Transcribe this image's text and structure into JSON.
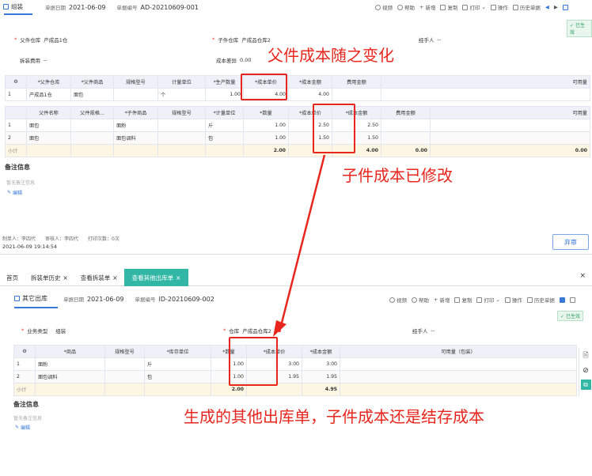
{
  "top": {
    "tab_label": "组装",
    "date_label": "单据日期",
    "date": "2021-06-09",
    "no_label": "单据编号",
    "no": "AD-20210609-001",
    "toolbar": [
      "视频",
      "帮助",
      "新增",
      "复制",
      "打印",
      "操作",
      "历史单据"
    ],
    "status": "已生效",
    "form": {
      "parent_wh_label": "父件仓库",
      "parent_wh": "产成品1仓",
      "child_wh_label": "子件仓库",
      "child_wh": "产成品仓库2",
      "handler_label": "经手人",
      "handler": "--",
      "fee_label": "拆装费用",
      "fee": "--",
      "diff_label": "成本差异",
      "diff": "0.00"
    },
    "parent_table": {
      "headers": [
        "*父件仓库",
        "*父件商品",
        "规格型号",
        "计量单位",
        "*生产数量",
        "*成本单价",
        "*成本金额",
        "费用金额",
        "可用量"
      ],
      "rows": [
        [
          "1",
          "产成品1仓",
          "面包",
          "",
          "个",
          "1.00",
          "4.00",
          "4.00",
          ""
        ]
      ]
    },
    "child_table": {
      "headers": [
        "父件名称",
        "父件规格...",
        "*子件商品",
        "规格型号",
        "*计量单位",
        "*数量",
        "*成本单价",
        "*成本金额",
        "费用金额",
        "可用量"
      ],
      "rows": [
        [
          "1",
          "面包",
          "",
          "面粉",
          "",
          "斤",
          "1.00",
          "2.50",
          "2.50",
          ""
        ],
        [
          "2",
          "面包",
          "",
          "面包调料",
          "",
          "包",
          "1.00",
          "1.50",
          "1.50",
          ""
        ]
      ],
      "subtotal_label": "小计",
      "subtotal": [
        "2.00",
        "4.00",
        "0.00",
        "0.00"
      ]
    },
    "remark_title": "备注信息",
    "remark_empty": "暂无备注信息",
    "edit": "编辑",
    "maker": "制单人：李四代",
    "auditor": "审核人：李四代",
    "print_count": "打印次数：0次",
    "timestamp": "2021-06-09 19:14:54",
    "reverse_btn": "弃审"
  },
  "bottom": {
    "tabs": [
      "首页",
      "拆装单历史",
      "查看拆装单",
      "查看其他出库单"
    ],
    "title": "其它出库",
    "date_label": "单据日期",
    "date": "2021-06-09",
    "no_label": "单据编号",
    "no": "ID-20210609-002",
    "toolbar": [
      "视频",
      "帮助",
      "新增",
      "复制",
      "打印",
      "操作",
      "历史单据"
    ],
    "status": "已生效",
    "form": {
      "biz_label": "业务类型",
      "biz": "组装",
      "wh_label": "仓库",
      "wh": "产成品仓库2",
      "handler_label": "经手人",
      "handler": "--"
    },
    "table": {
      "headers": [
        "*商品",
        "规格型号",
        "*库存单位",
        "*数量",
        "*成本单价",
        "*成本金额",
        "可用量（包装）"
      ],
      "rows": [
        [
          "1",
          "面粉",
          "",
          "斤",
          "1.00",
          "3.00",
          "3.00",
          ""
        ],
        [
          "2",
          "面包调料",
          "",
          "包",
          "1.00",
          "1.95",
          "1.95",
          ""
        ]
      ],
      "subtotal_label": "小计",
      "subtotal": [
        "2.00",
        "4.95"
      ]
    },
    "remark_title": "备注信息",
    "remark_empty": "暂无备注信息",
    "edit": "编辑"
  },
  "annotations": {
    "a1": "父件成本随之变化",
    "a2": "子件成本已修改",
    "a3": "生成的其他出库单，子件成本还是结存成本"
  }
}
